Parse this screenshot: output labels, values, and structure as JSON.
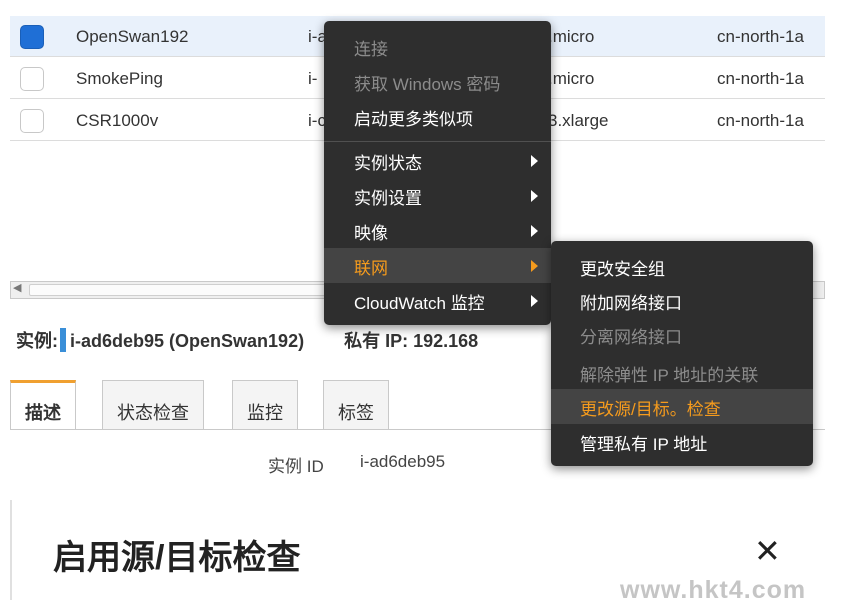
{
  "table": {
    "rows": [
      {
        "name": "OpenSwan192",
        "id": "i-a",
        "type": ".micro",
        "region": "cn-north-1a",
        "checked": true
      },
      {
        "name": "SmokePing",
        "id": "i-",
        "type": ".micro",
        "region": "cn-north-1a",
        "checked": false
      },
      {
        "name": "CSR1000v",
        "id": "i-c",
        "type": "3.xlarge",
        "region": "cn-north-1a",
        "checked": false
      }
    ]
  },
  "instance_bar": {
    "label": "实例:",
    "value": "i-ad6deb95 (OpenSwan192)",
    "ip_label": "私有 IP: 192.168"
  },
  "tabs": [
    {
      "label": "描述",
      "active": true
    },
    {
      "label": "状态检查",
      "active": false
    },
    {
      "label": "监控",
      "active": false
    },
    {
      "label": "标签",
      "active": false
    }
  ],
  "details": {
    "instance_id_label": "实例 ID",
    "instance_id_value": "i-ad6deb95"
  },
  "context_menu": {
    "items": [
      {
        "label": "连接",
        "disabled": true
      },
      {
        "label": "获取 Windows 密码",
        "disabled": true
      },
      {
        "label": "启动更多类似项",
        "disabled": false
      },
      {
        "label": "实例状态",
        "submenu": true
      },
      {
        "label": "实例设置",
        "submenu": true
      },
      {
        "label": "映像",
        "submenu": true
      },
      {
        "label": "联网",
        "submenu": true,
        "highlight": true
      },
      {
        "label": "CloudWatch 监控",
        "submenu": true
      }
    ]
  },
  "networking_submenu": {
    "items": [
      {
        "label": "更改安全组",
        "disabled": false
      },
      {
        "label": "附加网络接口",
        "disabled": false
      },
      {
        "label": "分离网络接口",
        "disabled": true
      },
      {
        "label": "解除弹性 IP 地址的关联",
        "disabled": true
      },
      {
        "label": "更改源/目标。检查",
        "highlight": true
      },
      {
        "label": "管理私有 IP 地址",
        "disabled": false
      }
    ]
  },
  "modal": {
    "title": "启用源/目标检查",
    "close_symbol": "✕"
  },
  "watermark": "www.hkt4.com",
  "colors": {
    "menu_bg": "#2e2e2e",
    "menu_highlight_text": "#f59b1d",
    "checkbox_checked": "#1f6fd6",
    "tab_active_accent": "#f0a030"
  }
}
